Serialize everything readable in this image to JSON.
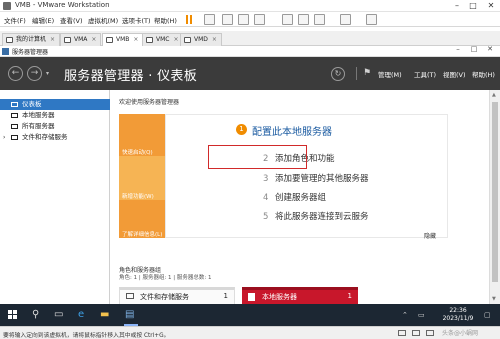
{
  "vmware": {
    "title": "VMB - VMware Workstation",
    "menu": [
      "文件(F)",
      "编辑(E)",
      "查看(V)",
      "虚拟机(M)",
      "选项卡(T)",
      "帮助(H)"
    ],
    "tabs": [
      {
        "label": "我的计算机",
        "active": false
      },
      {
        "label": "VMA",
        "active": false
      },
      {
        "label": "VMB",
        "active": true
      },
      {
        "label": "VMC",
        "active": false
      },
      {
        "label": "VMD",
        "active": false
      }
    ],
    "tab_close": "×"
  },
  "server_manager": {
    "window_title": "服务器管理器",
    "breadcrumb": "服务器管理器 · 仪表板",
    "header_menu": [
      "管理(M)",
      "工具(T)",
      "视图(V)",
      "帮助(H)"
    ]
  },
  "nav": {
    "items": [
      {
        "label": "仪表板",
        "active": true
      },
      {
        "label": "本地服务器",
        "active": false
      },
      {
        "label": "所有服务器",
        "active": false
      },
      {
        "label": "文件和存储服务",
        "active": false,
        "has_chevron": true
      }
    ]
  },
  "main": {
    "welcome": "欢迎使用服务器管理器",
    "quick_start_labels": [
      "快速启动(Q)",
      "新增功能(W)",
      "了解详细信息(L)"
    ],
    "step1": {
      "num": "1",
      "label": "配置此本地服务器"
    },
    "steps": [
      {
        "num": "2",
        "label": "添加角色和功能"
      },
      {
        "num": "3",
        "label": "添加要管理的其他服务器"
      },
      {
        "num": "4",
        "label": "创建服务器组"
      },
      {
        "num": "5",
        "label": "将此服务器连接到云服务"
      }
    ],
    "hide": "隐藏",
    "roles_header": "角色和服务器组",
    "roles_sub": "角色: 1 | 服务器组: 1 | 服务器总数: 1",
    "tiles": [
      {
        "label": "文件和存储服务",
        "count": "1"
      },
      {
        "label": "本地服务器",
        "count": "1"
      }
    ]
  },
  "taskbar": {
    "time": "22:36",
    "date": "2023/11/9"
  },
  "statusbar": {
    "text": "要将输入定向到该虚拟机，请将鼠标指针移入其中或按 Ctrl+G。",
    "watermark": "头条@小蜗网"
  },
  "colors": {
    "header_bg": "#3b3b3b",
    "accent_blue": "#2f78c4",
    "quickstart_orange": "#f29b37",
    "tile_red": "#c8172b",
    "highlight_red": "#d12a2a"
  }
}
